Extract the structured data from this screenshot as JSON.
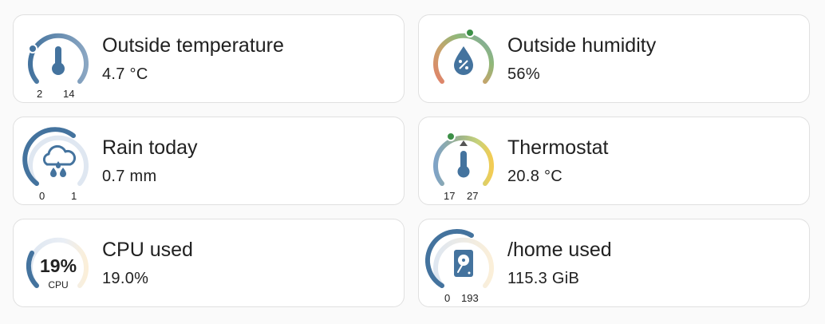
{
  "cards": [
    {
      "title": "Outside temperature",
      "value": "4.7 °C",
      "min": "2",
      "max": "14",
      "icon": "thermometer-icon"
    },
    {
      "title": "Outside humidity",
      "value": "56%",
      "icon": "water-percent-icon"
    },
    {
      "title": "Rain today",
      "value": "0.7 mm",
      "min": "0",
      "max": "1",
      "icon": "weather-pouring-icon"
    },
    {
      "title": "Thermostat",
      "value": "20.8 °C",
      "min": "17",
      "max": "27",
      "icon": "thermometer-icon"
    },
    {
      "title": "CPU used",
      "value": "19.0%",
      "gauge_number": "19",
      "gauge_unit": "%",
      "gauge_label": "CPU"
    },
    {
      "title": "/home used",
      "value": "115.3 GiB",
      "min": "0",
      "max": "193",
      "icon": "harddisk-icon"
    }
  ],
  "colors": {
    "primary": "#44739e",
    "track": "#dfe7f1",
    "card_border": "#e0e0e0",
    "indicator_green": "#3c8f47"
  }
}
